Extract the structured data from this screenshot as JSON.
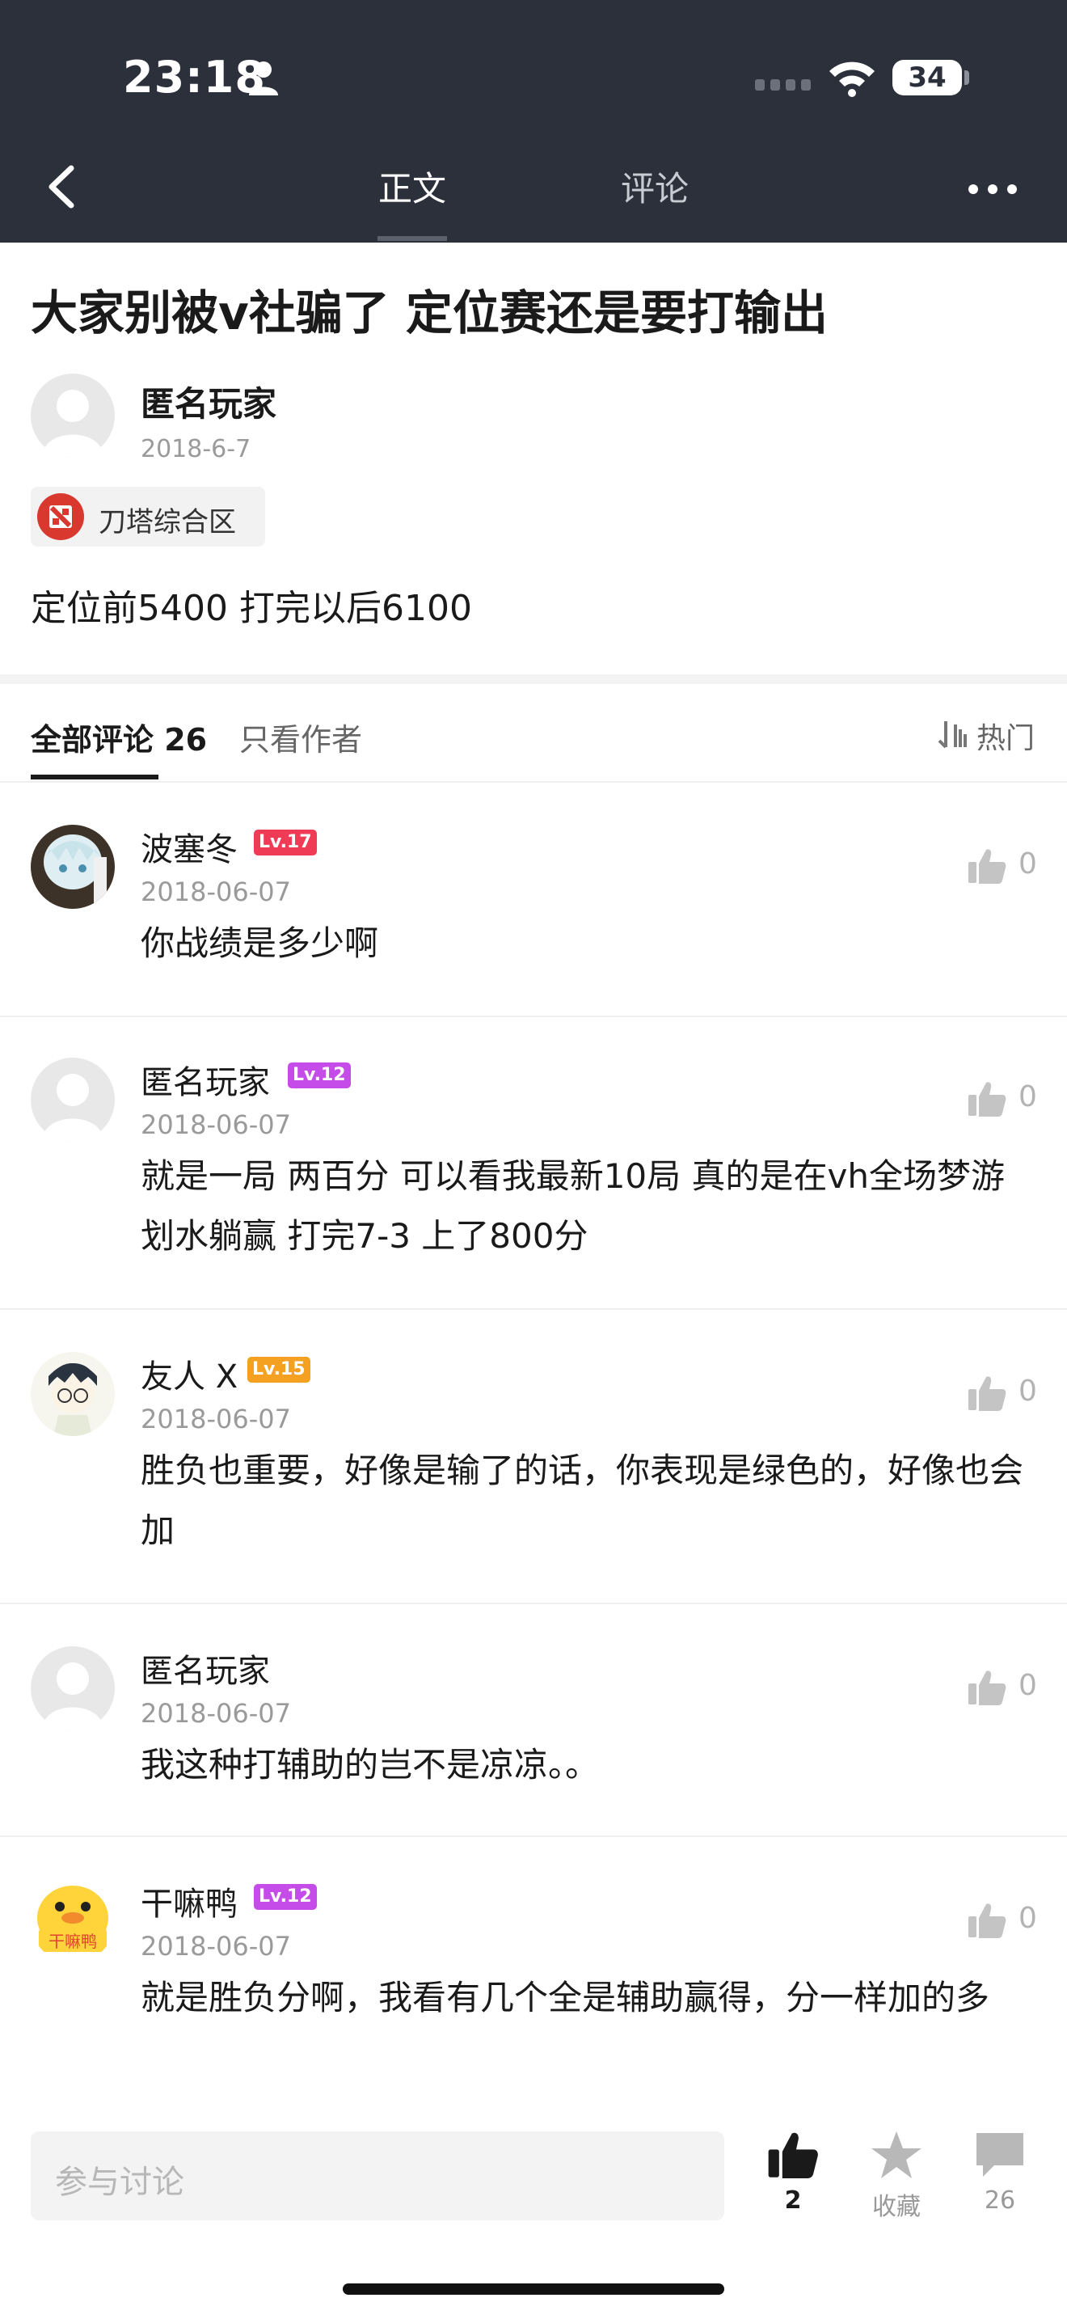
{
  "status_bar": {
    "time": "23:18",
    "battery": "34"
  },
  "nav": {
    "tabs": [
      {
        "label": "正文"
      },
      {
        "label": "评论"
      }
    ]
  },
  "post": {
    "title": "大家别被v社骗了 定位赛还是要打输出",
    "author": "匿名玩家",
    "date": "2018-6-7",
    "board": "刀塔综合区",
    "body": "定位前5400 打完以后6100"
  },
  "comments_header": {
    "all_label": "全部评论 26",
    "author_only_label": "只看作者",
    "sort_label": "热门"
  },
  "comments": [
    {
      "name": "波塞冬",
      "level": "Lv.17",
      "date": "2018-06-07",
      "text": "你战绩是多少啊",
      "likes": "0"
    },
    {
      "name": "匿名玩家",
      "level": "Lv.12",
      "date": "2018-06-07",
      "text": "就是一局 两百分  可以看我最新10局 真的是在vh全场梦游划水躺赢 打完7-3 上了800分",
      "likes": "0"
    },
    {
      "name": "友人 X",
      "level": "Lv.15",
      "date": "2018-06-07",
      "text": "胜负也重要，好像是输了的话，你表现是绿色的，好像也会加",
      "likes": "0"
    },
    {
      "name": "匿名玩家",
      "level": "",
      "date": "2018-06-07",
      "text": "我这种打辅助的岂不是凉凉。。",
      "likes": "0"
    },
    {
      "name": "干嘛鸭",
      "level": "Lv.12",
      "date": "2018-06-07",
      "text": "就是胜负分啊，我看有几个全是辅助赢得，分一样加的多",
      "likes": "0",
      "avatar_text": "干嘛鸭"
    }
  ],
  "bottom_bar": {
    "input_placeholder": "参与讨论",
    "like_count": "2",
    "favorite_label": "收藏",
    "comment_count": "26"
  },
  "colors": {
    "header_bg": "#2b303b",
    "level_red": "#ef3b55",
    "level_purple": "#c54ce8",
    "level_orange": "#f4a020"
  }
}
